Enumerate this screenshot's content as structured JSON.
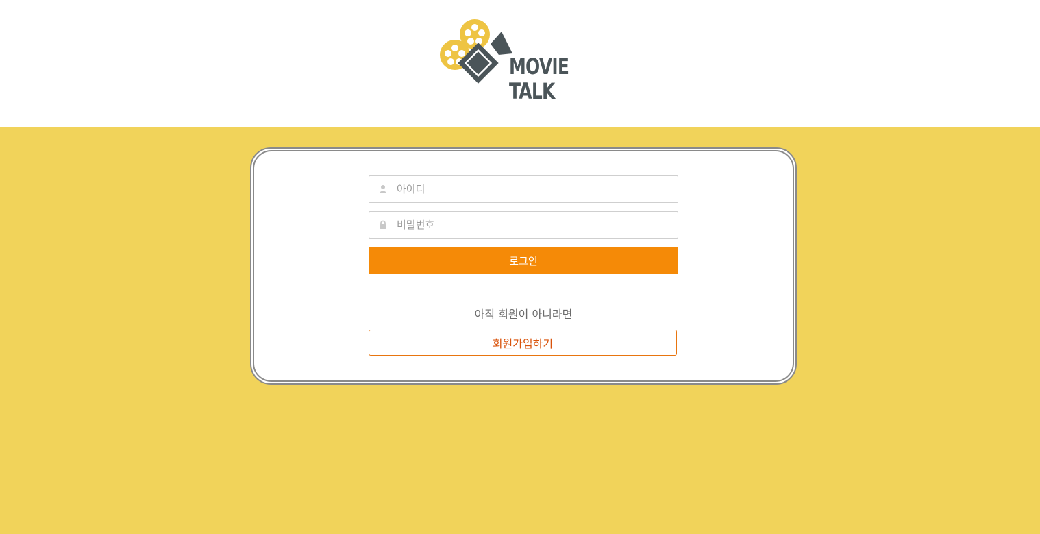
{
  "brand": {
    "logo_line1": "MOVIE",
    "logo_line2": "TALK",
    "colors": {
      "reel_yellow": "#eec443",
      "camera_gray": "#4b5559",
      "background_yellow": "#f1d35a",
      "accent_orange": "#f58a07"
    }
  },
  "login": {
    "id_field": {
      "placeholder": "아이디",
      "value": "",
      "icon": "user-icon"
    },
    "password_field": {
      "placeholder": "비밀번호",
      "value": "",
      "icon": "lock-icon"
    },
    "login_button_label": "로그인",
    "not_member_text": "아직 회원이 아니라면",
    "signup_button_label": "회원가입하기"
  }
}
